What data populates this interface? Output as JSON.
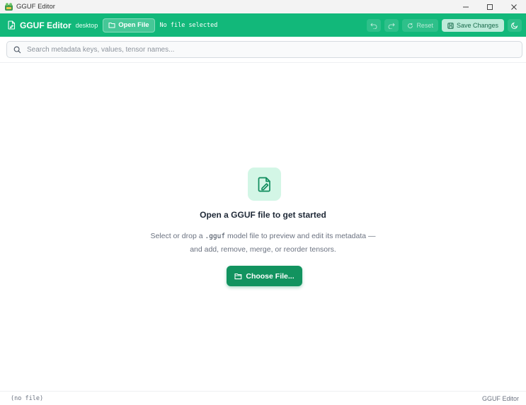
{
  "window": {
    "title": "GGUF Editor"
  },
  "toolbar": {
    "app_name": "GGUF Editor",
    "env": "desktop",
    "open_label": "Open File",
    "file_status": "No file selected",
    "reset_label": "Reset",
    "save_label": "Save Changes"
  },
  "search": {
    "placeholder": "Search metadata keys, values, tensor names..."
  },
  "empty_state": {
    "title": "Open a GGUF file to get started",
    "desc_before": "Select or drop a ",
    "desc_code": ".gguf",
    "desc_after": " model file to preview and edit its metadata —",
    "desc_line2": "and add, remove, merge, or reorder tensors.",
    "button_label": "Choose File..."
  },
  "status_bar": {
    "left": "(no file)",
    "right": "GGUF Editor"
  },
  "colors": {
    "accent": "#12b87a",
    "button": "#12935f",
    "tile": "#d3f6e6"
  },
  "icons": {
    "app": "app-logo-icon",
    "file": "file-icon",
    "folder": "folder-open-icon",
    "undo": "undo-icon",
    "redo": "redo-icon",
    "reset": "reset-icon",
    "save": "save-icon",
    "theme": "moon-icon",
    "search": "search-icon",
    "document": "file-edit-icon"
  }
}
